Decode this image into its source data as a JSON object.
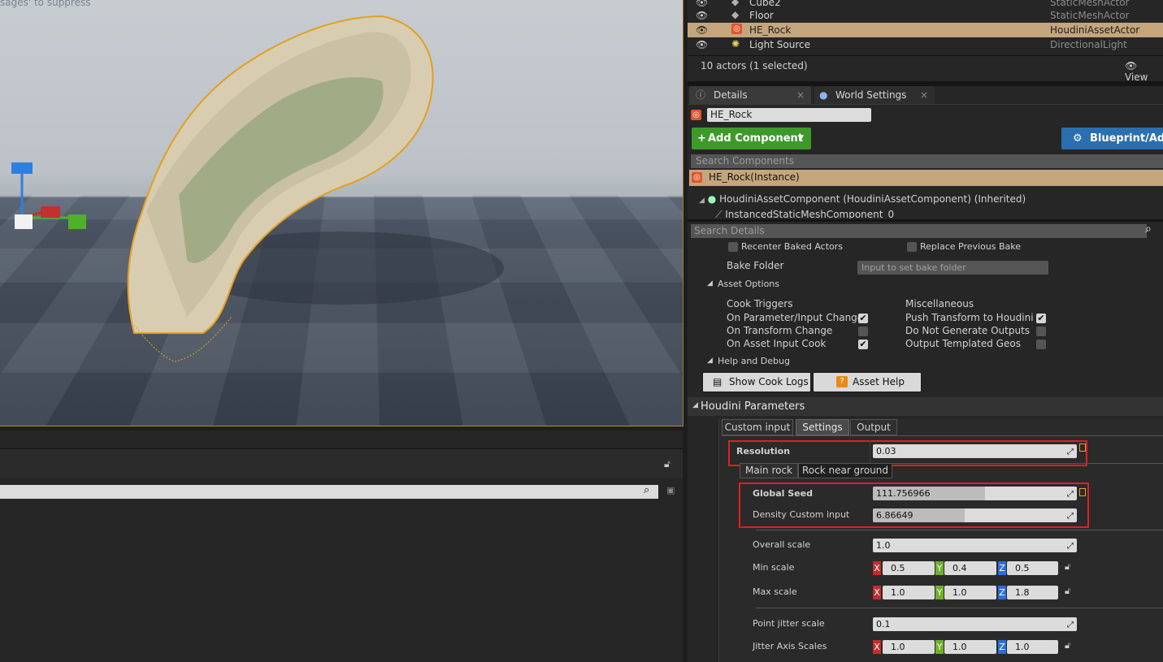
{
  "viewport": {
    "hint_text": "sages' to suppress"
  },
  "outliner": {
    "rows": [
      {
        "name": "Cube2",
        "type": "StaticMeshActor",
        "icon": "static-mesh-icon"
      },
      {
        "name": "Floor",
        "type": "StaticMeshActor",
        "icon": "static-mesh-icon"
      },
      {
        "name": "HE_Rock",
        "type": "HoudiniAssetActor",
        "icon": "houdini-icon",
        "selected": true
      },
      {
        "name": "Light Source",
        "type": "DirectionalLight",
        "icon": "light-icon"
      }
    ],
    "footer_count": "10 actors (1 selected)",
    "view_options_label": "View"
  },
  "tabs": {
    "details": "Details",
    "world_settings": "World Settings"
  },
  "details": {
    "actor_name": "HE_Rock",
    "add_component_label": "Add Component",
    "blueprint_label": "Blueprint/Add",
    "search_components_placeholder": "Search Components",
    "instance_label": "HE_Rock(Instance)",
    "component_tree": [
      "HoudiniAssetComponent (HoudiniAssetComponent) (Inherited)",
      "InstancedStaticMeshComponent_0"
    ],
    "search_details_placeholder": "Search Details",
    "recenter_baked_actors": "Recenter Baked Actors",
    "replace_previous_bake": "Replace Previous Bake",
    "bake_folder_label": "Bake Folder",
    "bake_folder_placeholder": "Input to set bake folder",
    "asset_options_header": "Asset Options",
    "cook_triggers_header": "Cook Triggers",
    "miscellaneous_header": "Miscellaneous",
    "cook_triggers": [
      {
        "label": "On Parameter/Input Change",
        "checked": true
      },
      {
        "label": "On Transform Change",
        "checked": false
      },
      {
        "label": "On Asset Input Cook",
        "checked": true
      }
    ],
    "misc_options": [
      {
        "label": "Push Transform to Houdini",
        "checked": true
      },
      {
        "label": "Do Not Generate Outputs",
        "checked": false
      },
      {
        "label": "Output Templated Geos",
        "checked": false
      }
    ],
    "help_debug_header": "Help and Debug",
    "show_cook_logs_label": "Show Cook Logs",
    "asset_help_label": "Asset Help"
  },
  "houdini": {
    "header": "Houdini Parameters",
    "tabs": [
      "Custom input",
      "Settings",
      "Output"
    ],
    "active_tab": "Settings",
    "resolution_label": "Resolution",
    "resolution_value": "0.03",
    "subtabs": [
      "Main rock",
      "Rock near ground"
    ],
    "global_seed_label": "Global Seed",
    "global_seed_value": "111.756966",
    "global_seed_fraction": 0.55,
    "density_label": "Density Custom input",
    "density_value": "6.86649",
    "density_fraction": 0.45,
    "overall_scale_label": "Overall scale",
    "overall_scale_value": "1.0",
    "min_scale_label": "Min scale",
    "min_scale": {
      "x": "0.5",
      "y": "0.4",
      "z": "0.5"
    },
    "max_scale_label": "Max scale",
    "max_scale": {
      "x": "1.0",
      "y": "1.0",
      "z": "1.8"
    },
    "point_jitter_label": "Point jitter scale",
    "point_jitter_value": "0.1",
    "jitter_axis_label": "Jitter Axis Scales",
    "jitter_axis": {
      "x": "1.0",
      "y": "1.0",
      "z": "1.0"
    },
    "axis_letters": {
      "x": "X",
      "y": "Y",
      "z": "Z"
    }
  },
  "colors": {
    "selection": "#c5a67c",
    "add_component_green": "#3d9a2a",
    "blueprint_blue": "#2a6fb0",
    "highlight_red": "#e02020"
  }
}
